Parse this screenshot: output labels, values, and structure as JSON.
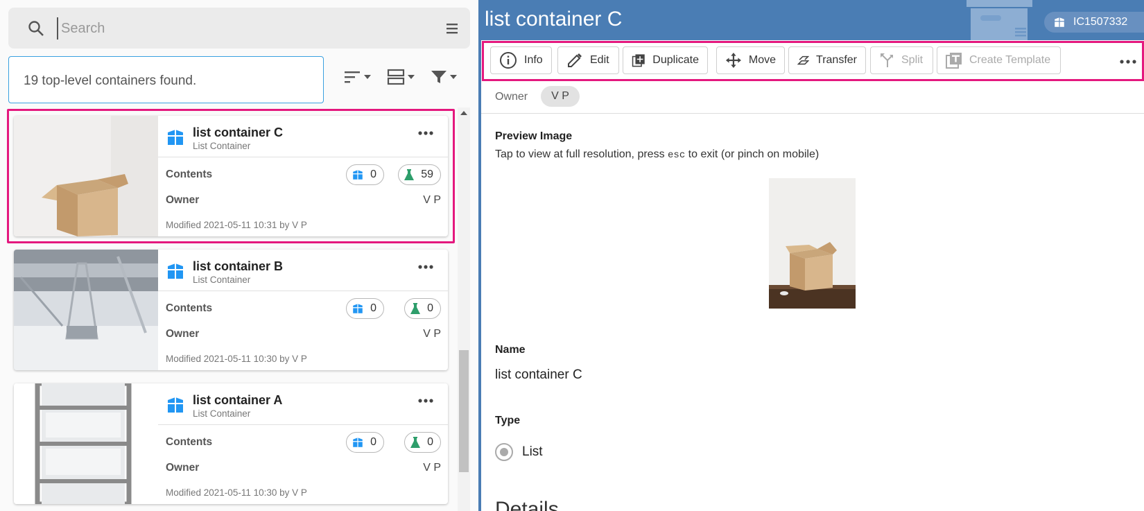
{
  "search": {
    "placeholder": "Search"
  },
  "results": {
    "found_text": "19 top-level containers found."
  },
  "cards": [
    {
      "title": "list container C",
      "subtitle": "List Container",
      "contents_label": "Contents",
      "containers_count": "0",
      "samples_count": "59",
      "owner_label": "Owner",
      "owner": "V P",
      "modified": "Modified 2021-05-11 10:31 by V P"
    },
    {
      "title": "list container B",
      "subtitle": "List Container",
      "contents_label": "Contents",
      "containers_count": "0",
      "samples_count": "0",
      "owner_label": "Owner",
      "owner": "V P",
      "modified": "Modified 2021-05-11 10:30 by V P"
    },
    {
      "title": "list container A",
      "subtitle": "List Container",
      "contents_label": "Contents",
      "containers_count": "0",
      "samples_count": "0",
      "owner_label": "Owner",
      "owner": "V P",
      "modified": "Modified 2021-05-11 10:30 by V P"
    }
  ],
  "detail": {
    "title": "list container C",
    "global_id": "IC1507332",
    "actions": {
      "info": "Info",
      "edit": "Edit",
      "duplicate": "Duplicate",
      "move": "Move",
      "transfer": "Transfer",
      "split": "Split",
      "create_template": "Create Template"
    },
    "owner_label": "Owner",
    "owner": "V P",
    "preview_label": "Preview Image",
    "preview_help_1": "Tap to view at full resolution, press ",
    "preview_help_key": "esc",
    "preview_help_2": " to exit (or pinch on mobile)",
    "name_label": "Name",
    "name_value": "list container C",
    "type_label": "Type",
    "type_value": "List",
    "details_heading": "Details"
  },
  "colors": {
    "accent_blue": "#4a7db4",
    "container_icon_blue": "#2196f3",
    "sample_icon_green": "#2e9e6b",
    "highlight_pink": "#e4187e"
  }
}
